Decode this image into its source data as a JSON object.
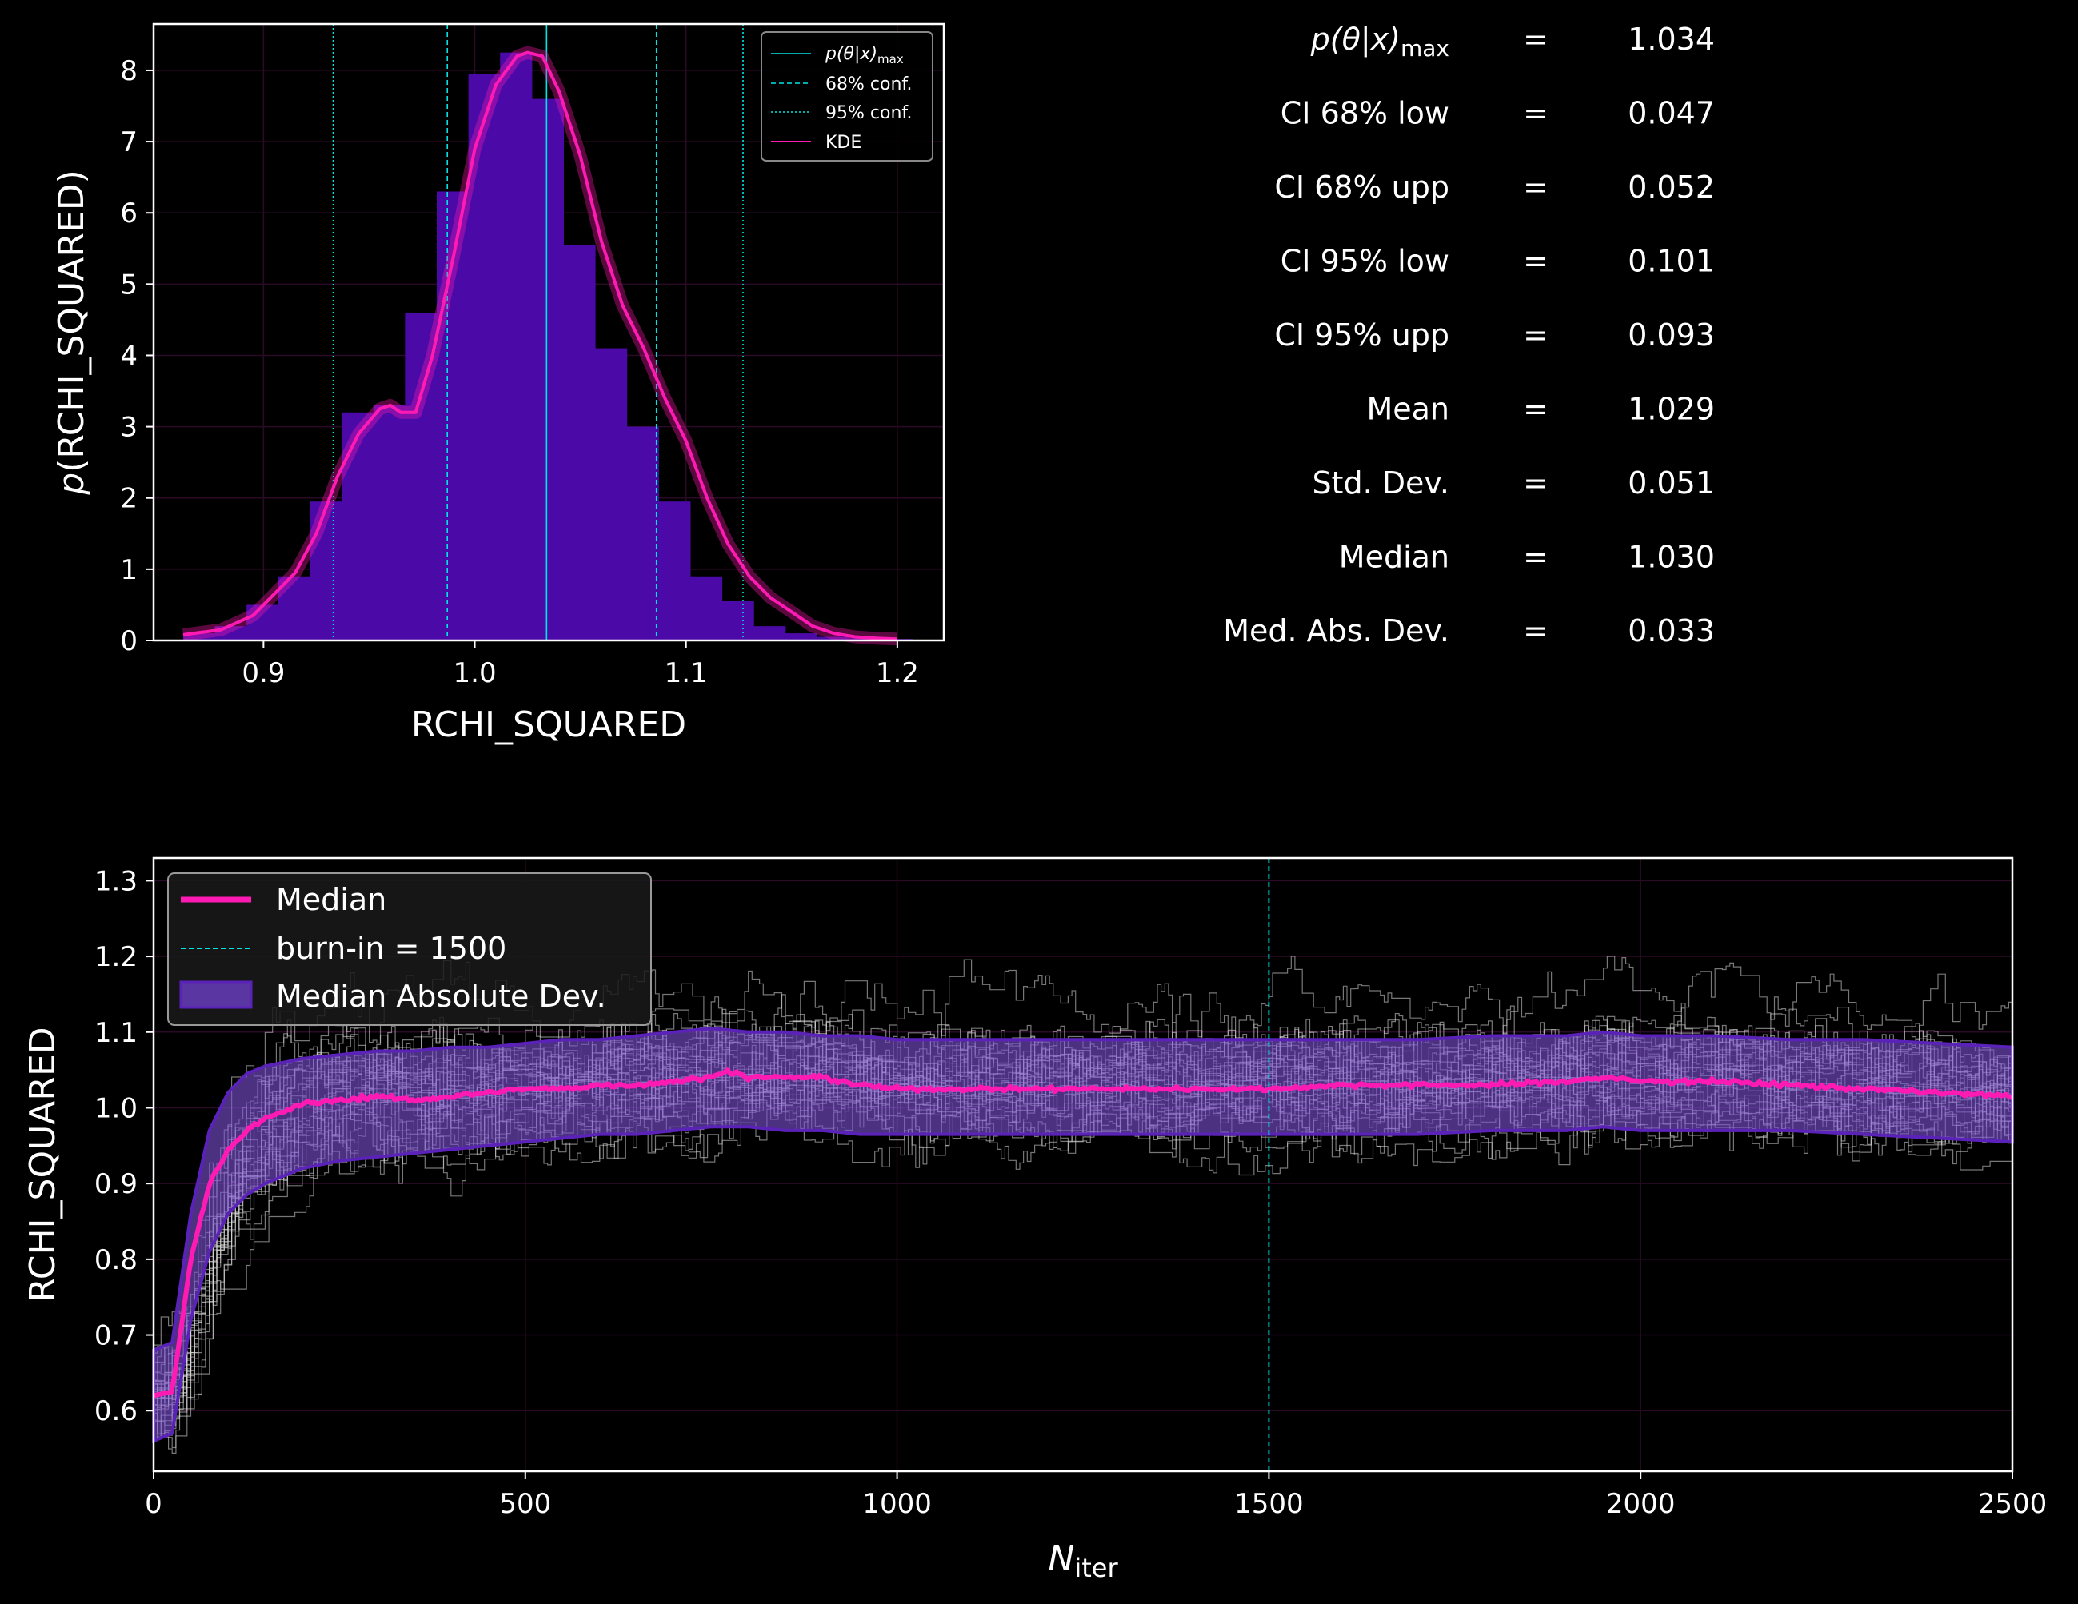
{
  "colors": {
    "background": "#000000",
    "histogram": "#4b0aa8",
    "kde": "#ff1ab3",
    "kde_glow": "#ff1ab3",
    "cyan": "#00e5e5",
    "mad_band": "#8a5fd6",
    "median_line": "#ff1ab3",
    "grid": "#2a0a24",
    "traces": "#d8d8d8"
  },
  "chart_data": [
    {
      "type": "bar",
      "id": "posterior-histogram",
      "xlabel": "RCHI_SQUARED",
      "ylabel": "p(RCHI_SQUARED)",
      "xlim": [
        0.848,
        1.222
      ],
      "ylim": [
        0,
        8.65
      ],
      "xticks": [
        "0.9",
        "1.0",
        "1.1",
        "1.2"
      ],
      "xtick_values": [
        0.9,
        1.0,
        1.1,
        1.2
      ],
      "yticks": [
        "0",
        "1",
        "2",
        "3",
        "4",
        "5",
        "6",
        "7",
        "8"
      ],
      "bin_edges": [
        0.862,
        0.877,
        0.892,
        0.907,
        0.922,
        0.937,
        0.952,
        0.967,
        0.982,
        0.997,
        1.012,
        1.027,
        1.042,
        1.057,
        1.072,
        1.087,
        1.102,
        1.117,
        1.132,
        1.147,
        1.162,
        1.177,
        1.192,
        1.207
      ],
      "bin_values": [
        0.1,
        0.2,
        0.5,
        0.9,
        1.95,
        3.2,
        3.3,
        4.6,
        6.3,
        7.95,
        8.25,
        7.6,
        5.55,
        4.1,
        3.0,
        1.95,
        0.9,
        0.55,
        0.2,
        0.1,
        0.05,
        0.03,
        0.02
      ],
      "kde": {
        "x": [
          0.862,
          0.88,
          0.895,
          0.905,
          0.915,
          0.925,
          0.935,
          0.945,
          0.955,
          0.96,
          0.965,
          0.972,
          0.98,
          0.99,
          1.0,
          1.01,
          1.02,
          1.025,
          1.032,
          1.04,
          1.05,
          1.06,
          1.07,
          1.08,
          1.09,
          1.1,
          1.11,
          1.12,
          1.13,
          1.14,
          1.15,
          1.16,
          1.17,
          1.18,
          1.19,
          1.2
        ],
        "y": [
          0.08,
          0.15,
          0.35,
          0.65,
          0.95,
          1.5,
          2.3,
          2.9,
          3.25,
          3.3,
          3.2,
          3.2,
          4.0,
          5.4,
          6.9,
          7.8,
          8.2,
          8.25,
          8.2,
          7.7,
          6.8,
          5.6,
          4.7,
          4.1,
          3.4,
          2.8,
          2.0,
          1.35,
          0.9,
          0.6,
          0.4,
          0.2,
          0.1,
          0.05,
          0.03,
          0.02
        ]
      },
      "vlines": {
        "max": 1.034,
        "conf68": [
          0.987,
          1.086
        ],
        "conf95": [
          0.933,
          1.127
        ]
      },
      "legend": {
        "position": "top-right",
        "entries": [
          {
            "label_main": "p(θ|x)",
            "label_sub": "max",
            "style": "solid"
          },
          {
            "label": "68% conf.",
            "style": "dashed"
          },
          {
            "label": "95% conf.",
            "style": "dotted"
          },
          {
            "label": "KDE",
            "style": "kde"
          }
        ]
      }
    },
    {
      "type": "line",
      "id": "trace-plot",
      "xlabel_main": "N",
      "xlabel_sub": "iter",
      "ylabel": "RCHI_SQUARED",
      "xlim": [
        0,
        2500
      ],
      "ylim": [
        0.52,
        1.33
      ],
      "xticks": [
        "0",
        "500",
        "1000",
        "1500",
        "2000",
        "2500"
      ],
      "xtick_values": [
        0,
        500,
        1000,
        1500,
        2000,
        2500
      ],
      "yticks": [
        "0.6",
        "0.7",
        "0.8",
        "0.9",
        "1.0",
        "1.1",
        "1.2",
        "1.3"
      ],
      "ytick_values": [
        0.6,
        0.7,
        0.8,
        0.9,
        1.0,
        1.1,
        1.2,
        1.3
      ],
      "burn_in": 1500,
      "median": {
        "x": [
          0,
          25,
          50,
          75,
          100,
          125,
          150,
          175,
          200,
          250,
          300,
          350,
          400,
          450,
          500,
          550,
          600,
          650,
          700,
          750,
          770,
          800,
          850,
          900,
          950,
          1000,
          1100,
          1200,
          1300,
          1400,
          1500,
          1600,
          1700,
          1800,
          1900,
          1950,
          2000,
          2100,
          2200,
          2300,
          2400,
          2500
        ],
        "y": [
          0.62,
          0.625,
          0.8,
          0.9,
          0.945,
          0.97,
          0.985,
          0.995,
          1.005,
          1.01,
          1.015,
          1.01,
          1.015,
          1.02,
          1.025,
          1.025,
          1.03,
          1.03,
          1.035,
          1.04,
          1.05,
          1.04,
          1.04,
          1.04,
          1.03,
          1.025,
          1.025,
          1.025,
          1.025,
          1.025,
          1.025,
          1.03,
          1.03,
          1.03,
          1.035,
          1.04,
          1.035,
          1.035,
          1.03,
          1.025,
          1.02,
          1.015
        ]
      },
      "mad_band": {
        "x": [
          0,
          25,
          50,
          75,
          100,
          125,
          150,
          175,
          200,
          250,
          300,
          350,
          400,
          450,
          500,
          550,
          600,
          650,
          700,
          750,
          800,
          850,
          900,
          950,
          1000,
          1100,
          1200,
          1300,
          1400,
          1500,
          1600,
          1700,
          1800,
          1900,
          1950,
          2000,
          2100,
          2200,
          2300,
          2400,
          2500
        ],
        "upper": [
          0.68,
          0.69,
          0.86,
          0.97,
          1.02,
          1.045,
          1.055,
          1.06,
          1.065,
          1.07,
          1.075,
          1.075,
          1.08,
          1.08,
          1.085,
          1.09,
          1.09,
          1.095,
          1.1,
          1.105,
          1.1,
          1.1,
          1.095,
          1.095,
          1.09,
          1.09,
          1.09,
          1.09,
          1.09,
          1.09,
          1.09,
          1.09,
          1.095,
          1.095,
          1.1,
          1.095,
          1.095,
          1.09,
          1.09,
          1.085,
          1.08
        ],
        "lower": [
          0.56,
          0.57,
          0.72,
          0.81,
          0.86,
          0.885,
          0.9,
          0.91,
          0.92,
          0.93,
          0.935,
          0.94,
          0.945,
          0.95,
          0.955,
          0.96,
          0.965,
          0.965,
          0.97,
          0.975,
          0.975,
          0.97,
          0.97,
          0.965,
          0.965,
          0.965,
          0.965,
          0.965,
          0.965,
          0.965,
          0.965,
          0.965,
          0.97,
          0.97,
          0.975,
          0.97,
          0.97,
          0.97,
          0.965,
          0.96,
          0.955
        ]
      },
      "legend": {
        "position": "top-left",
        "entries": [
          {
            "label": "Median",
            "style": "thick-line"
          },
          {
            "label": "burn-in = 1500",
            "style": "dashed"
          },
          {
            "label": "Median Absolute Dev.",
            "style": "band"
          }
        ]
      }
    }
  ],
  "stats": [
    {
      "label_main": "p(θ|x)",
      "label_sub": "max",
      "eq": "=",
      "value": "1.034"
    },
    {
      "label": "CI 68% low",
      "eq": "=",
      "value": "0.047"
    },
    {
      "label": "CI 68% upp",
      "eq": "=",
      "value": "0.052"
    },
    {
      "label": "CI 95% low",
      "eq": "=",
      "value": "0.101"
    },
    {
      "label": "CI 95% upp",
      "eq": "=",
      "value": "0.093"
    },
    {
      "label": "Mean",
      "eq": "=",
      "value": "1.029"
    },
    {
      "label": "Std.  Dev.",
      "eq": "=",
      "value": "0.051"
    },
    {
      "label": "Median",
      "eq": "=",
      "value": "1.030"
    },
    {
      "label": "Med. Abs. Dev.",
      "eq": "=",
      "value": "0.033"
    }
  ]
}
